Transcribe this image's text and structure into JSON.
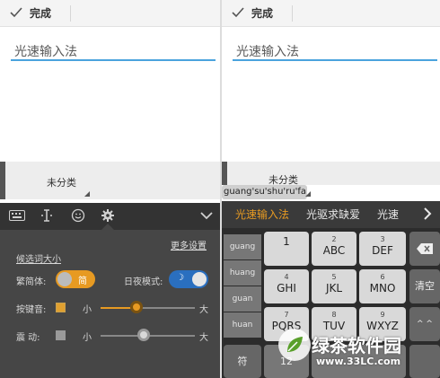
{
  "left": {
    "topbar": {
      "done_label": "完成"
    },
    "input": {
      "value": "光速输入法"
    },
    "category": {
      "label": "未分类"
    },
    "toolbar": {
      "icons": [
        "keyboard-icon",
        "cursor-icon",
        "emoji-icon",
        "gear-icon",
        "chevron-down-icon"
      ]
    },
    "settings": {
      "more_label": "更多设置",
      "candidate_size_label": "候选词大小",
      "trad_simp_label": "繁简体:",
      "trad_simp_value": "简",
      "day_night_label": "日夜模式:",
      "day_night_value": "☽",
      "key_sound_label": "按键音:",
      "key_sound_checked": true,
      "vibrate_label": "震 动:",
      "vibrate_checked": false,
      "small_label": "小",
      "large_label": "大",
      "key_sound_level": 0.35,
      "vibrate_level": 0.45
    },
    "colors": {
      "accent_orange": "#e79a22",
      "accent_blue": "#2a6fbf"
    }
  },
  "right": {
    "topbar": {
      "done_label": "完成"
    },
    "input": {
      "value": "光速输入法"
    },
    "category": {
      "label": "未分类"
    },
    "pinyin_tip": "guang'su'shu'ru'fa",
    "candidates": [
      "光速输入法",
      "光驱求缺爱",
      "光速"
    ],
    "pinyin_list": [
      "guang",
      "huang",
      "guan",
      "huan"
    ],
    "keys": [
      {
        "num": "",
        "label": "1"
      },
      {
        "num": "2",
        "label": "ABC"
      },
      {
        "num": "3",
        "label": "DEF"
      },
      {
        "num": "4",
        "label": "GHI"
      },
      {
        "num": "5",
        "label": "JKL"
      },
      {
        "num": "6",
        "label": "MNO"
      },
      {
        "num": "7",
        "label": "PQRS"
      },
      {
        "num": "8",
        "label": "TUV"
      },
      {
        "num": "9",
        "label": "WXYZ"
      }
    ],
    "clear_label": "清空",
    "symbol_label": "符",
    "bottom_partial": "12",
    "delete_icon": "backspace-icon",
    "up_label": "^ ^"
  },
  "watermark": {
    "brand": "绿茶软件园",
    "url": "www.33LC.com"
  }
}
